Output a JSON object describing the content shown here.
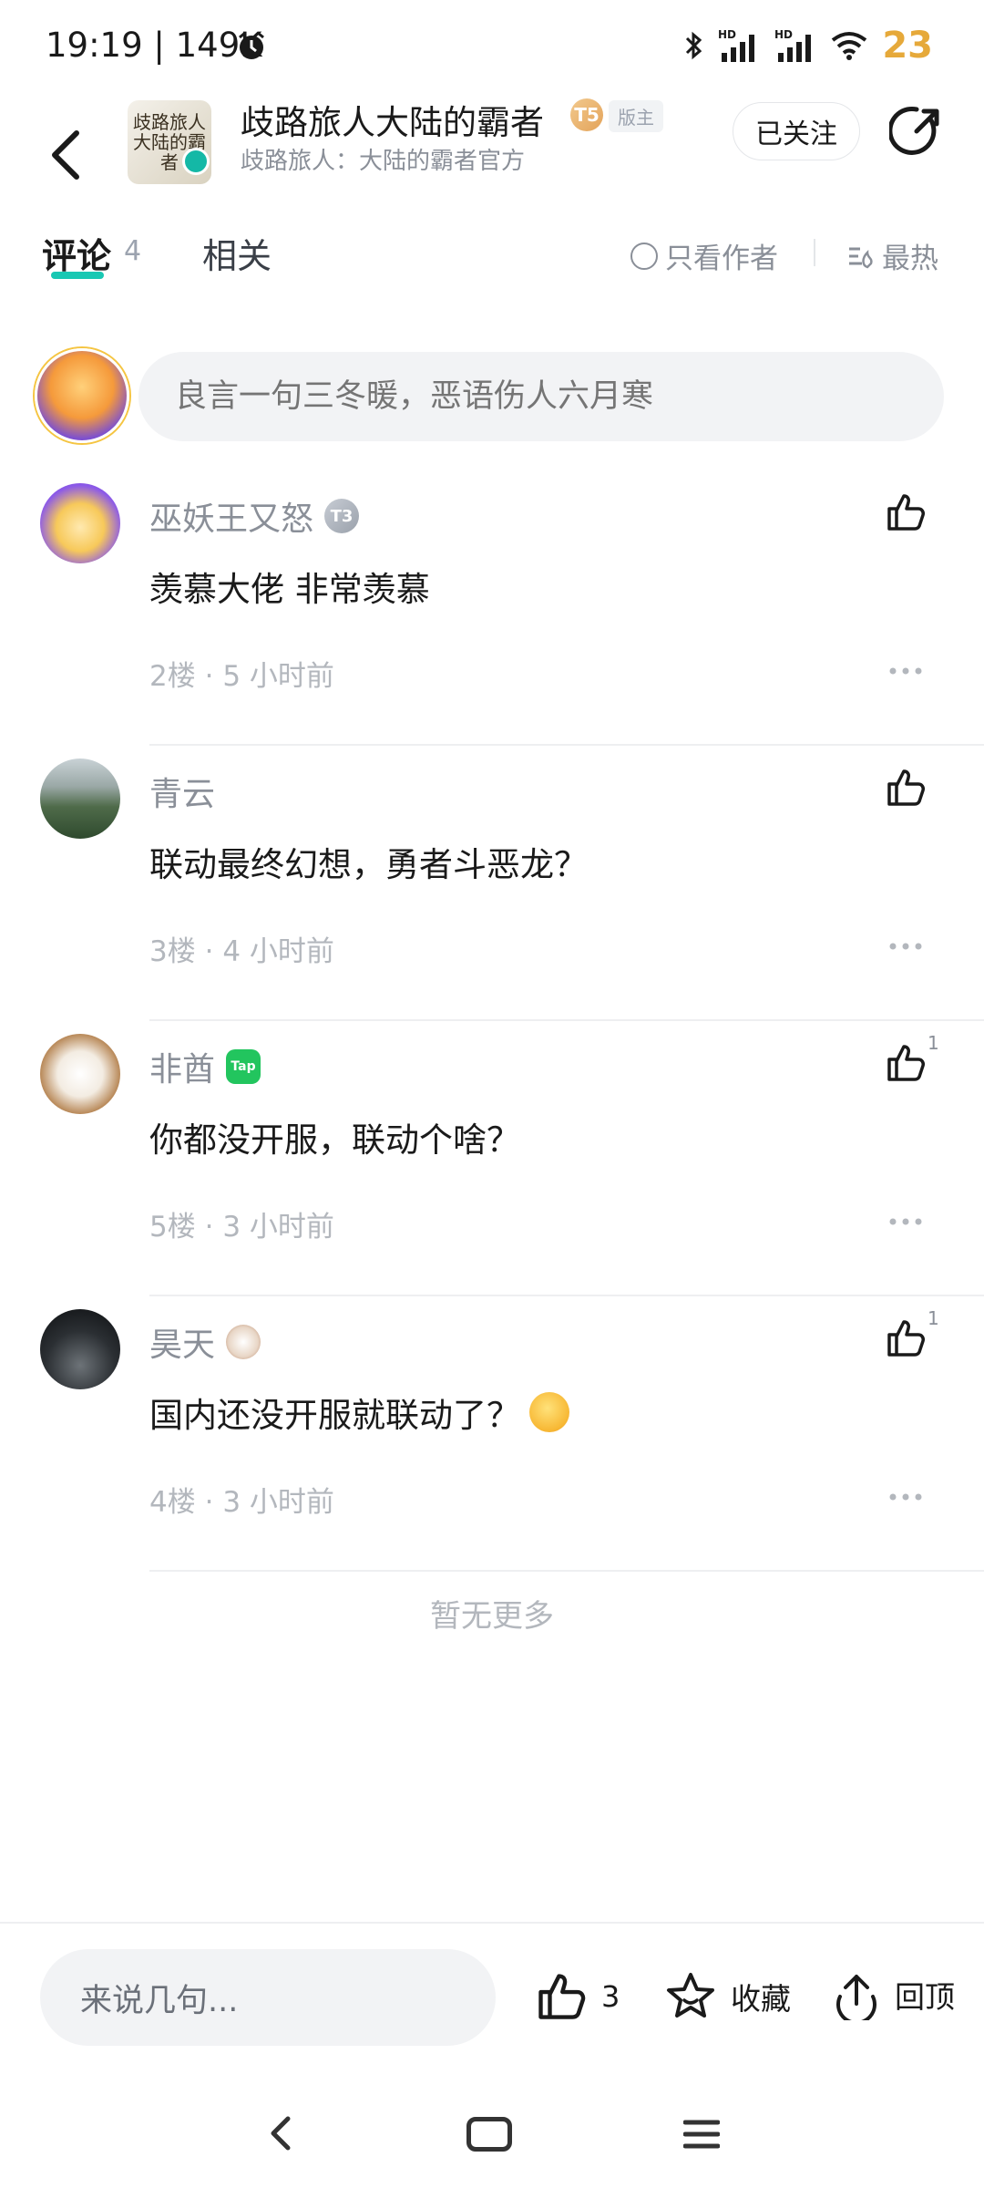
{
  "status_bar": {
    "time": "19:19 | 149K",
    "network": "HD",
    "battery": "23"
  },
  "header": {
    "logo_text": "歧路旅人 大陆的霸者",
    "title": "歧路旅人大陆的霸者",
    "level": "T5",
    "owner_tag": "版主",
    "subtitle": "歧路旅人：大陆的霸者官方",
    "follow_label": "已关注"
  },
  "tabs": {
    "comments_label": "评论",
    "comments_count": "4",
    "related_label": "相关",
    "author_only_label": "只看作者",
    "sort_label": "最热"
  },
  "composer": {
    "placeholder": "良言一句三冬暖，恶语伤人六月寒"
  },
  "comments": [
    {
      "name": "巫妖王又怒",
      "badge": "T3",
      "text": "羡慕大佬 非常羡慕",
      "floor": "2楼",
      "time": "5 小时前",
      "likes": ""
    },
    {
      "name": "青云",
      "badge": "",
      "text": "联动最终幻想，勇者斗恶龙？",
      "floor": "3楼",
      "time": "4 小时前",
      "likes": ""
    },
    {
      "name": "非酋",
      "badge": "Tap",
      "text": "你都没开服，联动个啥？",
      "floor": "5楼",
      "time": "3 小时前",
      "likes": "1"
    },
    {
      "name": "昊天",
      "badge": "",
      "text": "国内还没开服就联动了？",
      "floor": "4楼",
      "time": "3 小时前",
      "likes": "1"
    }
  ],
  "separator": "·",
  "no_more_label": "暂无更多",
  "bottom_bar": {
    "input_placeholder": "来说几句...",
    "like_count": "3",
    "favorite_label": "收藏",
    "top_label": "回顶"
  },
  "colors": {
    "accent": "#19c8b3",
    "battery": "#e6a93a",
    "muted": "#8a8f98"
  }
}
